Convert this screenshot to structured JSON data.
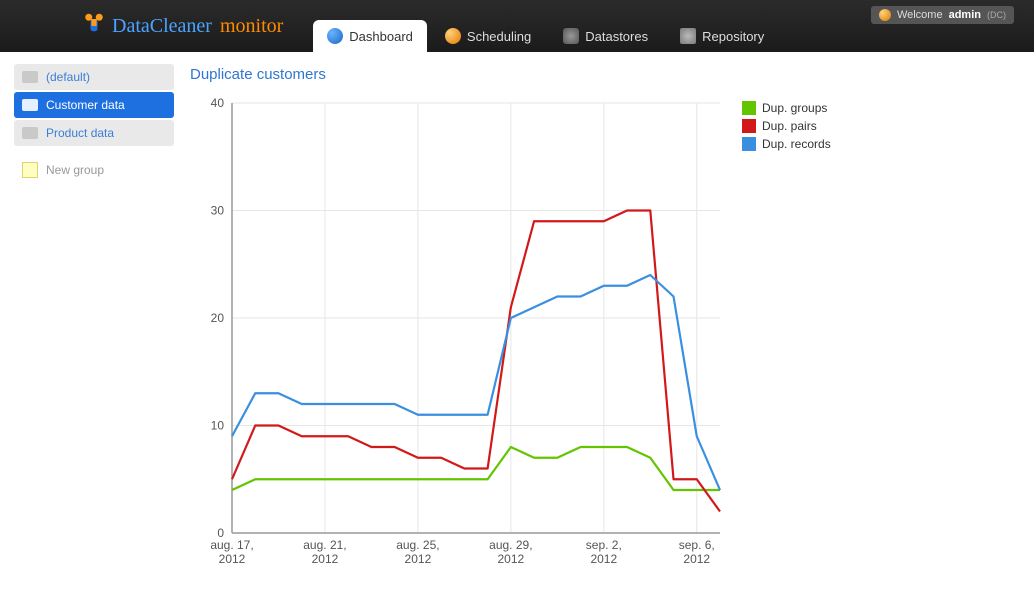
{
  "brand": {
    "name1": "DataCleaner",
    "name2": "monitor"
  },
  "user": {
    "welcome": "Welcome",
    "name": "admin",
    "ctx": "(DC)"
  },
  "nav": {
    "dashboard": "Dashboard",
    "scheduling": "Scheduling",
    "datastores": "Datastores",
    "repository": "Repository"
  },
  "sidebar": {
    "items": [
      {
        "label": "(default)"
      },
      {
        "label": "Customer data"
      },
      {
        "label": "Product data"
      }
    ],
    "new_group": "New group"
  },
  "chart_title": "Duplicate customers",
  "legend": {
    "groups": "Dup. groups",
    "pairs": "Dup. pairs",
    "records": "Dup. records"
  },
  "colors": {
    "groups": "#63c400",
    "pairs": "#d21919",
    "records": "#3a8fe0"
  },
  "chart_data": {
    "type": "line",
    "title": "Duplicate customers",
    "xlabel": "",
    "ylabel": "",
    "ylim": [
      0,
      40
    ],
    "y_ticks": [
      0,
      10,
      20,
      30,
      40
    ],
    "x_tick_labels": [
      "aug. 17, 2012",
      "aug. 21, 2012",
      "aug. 25, 2012",
      "aug. 29, 2012",
      "sep. 2, 2012",
      "sep. 6, 2012"
    ],
    "categories": [
      0,
      1,
      2,
      3,
      4,
      5,
      6,
      7,
      8,
      9,
      10,
      11,
      12,
      13,
      14,
      15,
      16,
      17,
      18,
      19,
      20,
      21
    ],
    "series": [
      {
        "name": "Dup. groups",
        "color": "#63c400",
        "values": [
          4,
          5,
          5,
          5,
          5,
          5,
          5,
          5,
          5,
          5,
          5,
          5,
          8,
          7,
          7,
          8,
          8,
          8,
          7,
          4,
          4,
          4
        ]
      },
      {
        "name": "Dup. pairs",
        "color": "#d21919",
        "values": [
          5,
          10,
          10,
          9,
          9,
          9,
          8,
          8,
          7,
          7,
          6,
          6,
          21,
          29,
          29,
          29,
          29,
          30,
          30,
          5,
          5,
          2
        ]
      },
      {
        "name": "Dup. records",
        "color": "#3a8fe0",
        "values": [
          9,
          13,
          13,
          12,
          12,
          12,
          12,
          12,
          11,
          11,
          11,
          11,
          20,
          21,
          22,
          22,
          23,
          23,
          24,
          22,
          9,
          4
        ]
      }
    ]
  }
}
